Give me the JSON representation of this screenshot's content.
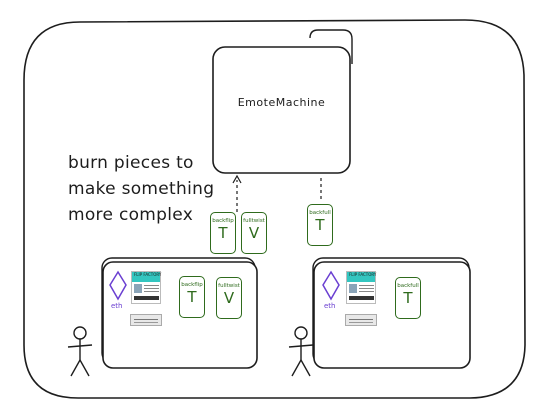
{
  "machine": {
    "label": "EmoteMachine"
  },
  "note": {
    "lines": [
      "burn pieces to",
      "make something",
      "more complex"
    ]
  },
  "burn_cards": [
    {
      "title": "backflip",
      "glyph": "T"
    },
    {
      "title": "fulltwist",
      "glyph": "V"
    },
    {
      "title": "backfull",
      "glyph": "T"
    }
  ],
  "wallets": [
    {
      "currency": "eth",
      "ticket": "FLIP FACTORY",
      "cards": [
        {
          "title": "backflip",
          "glyph": "T"
        },
        {
          "title": "fulltwist",
          "glyph": "V"
        }
      ]
    },
    {
      "currency": "eth",
      "ticket": "FLIP FACTORY",
      "cards": [
        {
          "title": "backfull",
          "glyph": "T"
        }
      ]
    }
  ],
  "colors": {
    "card": "#2f6b1d",
    "eth": "#6a3fd1",
    "ink": "#1d1d1d",
    "ticket": "#33c6c0"
  }
}
